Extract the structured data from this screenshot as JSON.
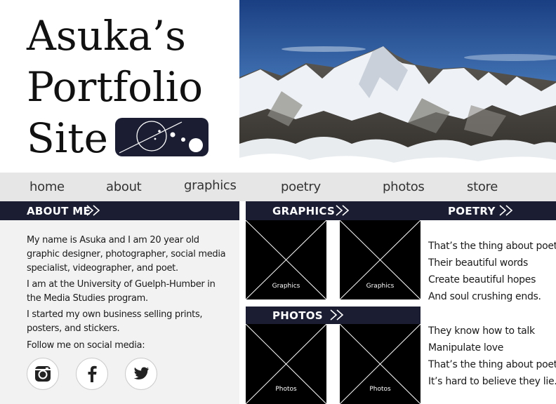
{
  "header": {
    "title_lines": [
      "Asuka’s",
      "Portfolio",
      "Site"
    ],
    "hero_image": "mountain-peaks-photo"
  },
  "nav": {
    "items": [
      {
        "label": "home"
      },
      {
        "label": "about"
      },
      {
        "label": "graphics"
      },
      {
        "label": "poetry"
      },
      {
        "label": "photos"
      },
      {
        "label": "store"
      }
    ]
  },
  "sections": {
    "about_title": "ABOUT ME",
    "graphics_title": "GRAPHICS",
    "poetry_title": "POETRY",
    "photos_title": "PHOTOS"
  },
  "about": {
    "p1": "My name is Asuka and I am 20 year old graphic designer, photographer, social media specialist, videographer, and poet.",
    "p2": "I am at the University of Guelph-Humber in the Media Studies program.",
    "p3": "I started my own business selling prints, posters, and stickers.",
    "p4": "Follow me on social media:",
    "social": [
      "instagram-icon",
      "facebook-icon",
      "twitter-icon"
    ]
  },
  "graphics": {
    "thumbs": [
      {
        "caption": "Graphics"
      },
      {
        "caption": "Graphics"
      }
    ]
  },
  "photos": {
    "thumbs": [
      {
        "caption": "Photos"
      },
      {
        "caption": "Photos"
      }
    ]
  },
  "poetry": {
    "lines": [
      "That’s the thing about poets",
      "Their beautiful words",
      "Create beautiful hopes",
      "And soul crushing ends.",
      "They know how to talk",
      "Manipulate love",
      "That’s the thing about poets",
      "It’s hard to believe they lie."
    ]
  },
  "colors": {
    "navy": "#1b1e33",
    "nav_bg": "#e6e6e6",
    "about_bg": "#f2f2f2"
  }
}
